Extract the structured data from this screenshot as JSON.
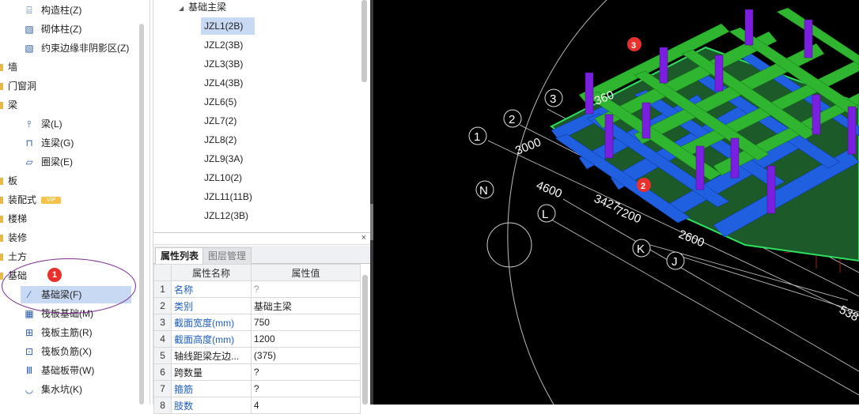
{
  "tree": {
    "items_top": [
      {
        "label": "构造柱(Z)",
        "icon": "column-icon"
      },
      {
        "label": "砌体柱(Z)",
        "icon": "masonry-column-icon"
      },
      {
        "label": "约束边缘非阴影区(Z)",
        "icon": "hatch-region-icon"
      }
    ],
    "categories": {
      "wall": "墙",
      "door_window": "门窗洞",
      "beam": "梁",
      "slab": "板",
      "prefab": "装配式",
      "prefab_badge": "VIP",
      "stairs": "楼梯",
      "decoration": "装修",
      "earthwork": "土方",
      "foundation": "基础"
    },
    "beam_items": [
      {
        "label": "梁(L)",
        "icon": "beam-icon"
      },
      {
        "label": "连梁(G)",
        "icon": "coupling-beam-icon"
      },
      {
        "label": "圈梁(E)",
        "icon": "ring-beam-icon"
      }
    ],
    "foundation_items": [
      {
        "label": "基础梁(F)",
        "icon": "foundation-beam-icon",
        "selected": true
      },
      {
        "label": "筏板基础(M)",
        "icon": "raft-foundation-icon"
      },
      {
        "label": "筏板主筋(R)",
        "icon": "raft-main-rebar-icon"
      },
      {
        "label": "筏板负筋(X)",
        "icon": "raft-negative-rebar-icon"
      },
      {
        "label": "基础板带(W)",
        "icon": "foundation-strip-icon"
      },
      {
        "label": "集水坑(K)",
        "icon": "sump-pit-icon"
      }
    ],
    "badge_1": "1"
  },
  "component_list": {
    "group": "基础主梁",
    "items": [
      "JZL1(2B)",
      "JZL2(3B)",
      "JZL3(3B)",
      "JZL4(3B)",
      "JZL6(5)",
      "JZL7(2)",
      "JZL8(2)",
      "JZL9(3A)",
      "JZL10(2)",
      "JZL11(11B)",
      "JZL12(3B)"
    ],
    "selected_index": 0
  },
  "properties": {
    "close": "×",
    "tabs": {
      "active": "属性列表",
      "inactive": "图层管理"
    },
    "headers": {
      "name": "属性名称",
      "value": "属性值"
    },
    "rows": [
      {
        "idx": "1",
        "name": "名称",
        "value": "?",
        "blue": true,
        "grey": true
      },
      {
        "idx": "2",
        "name": "类别",
        "value": "基础主梁",
        "blue": true,
        "grey": false
      },
      {
        "idx": "3",
        "name": "截面宽度(mm)",
        "value": "750",
        "blue": true,
        "grey": false
      },
      {
        "idx": "4",
        "name": "截面高度(mm)",
        "value": "1200",
        "blue": true,
        "grey": false
      },
      {
        "idx": "5",
        "name": "轴线距梁左边...",
        "value": "(375)",
        "blue": false,
        "grey": false
      },
      {
        "idx": "6",
        "name": "跨数量",
        "value": "?",
        "blue": false,
        "grey": false
      },
      {
        "idx": "7",
        "name": "箍筋",
        "value": "?",
        "blue": true,
        "grey": false
      },
      {
        "idx": "8",
        "name": "肢数",
        "value": "4",
        "blue": true,
        "grey": false
      }
    ]
  },
  "viewport": {
    "axes": {
      "a1": "1",
      "a2": "2",
      "a3": "3",
      "aN": "N",
      "aL": "L",
      "aK": "K",
      "aJ": "J"
    },
    "dims": {
      "d3000": "3000",
      "d4600": "4600",
      "d3427": "3427",
      "d7200": "7200",
      "d2600": "2600",
      "d360": "360",
      "d538": "538"
    },
    "badge_2": "2",
    "badge_3": "3",
    "colors": {
      "beam_green": "#2fb52f",
      "beam_blue": "#1f5fe0",
      "column_purple": "#7a1fe0",
      "slab_dark_green": "#1d5a2a",
      "grid_red": "#cc2222"
    }
  }
}
